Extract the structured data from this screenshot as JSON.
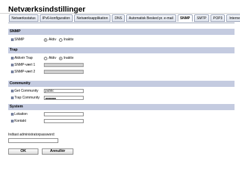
{
  "window": {
    "title": "Netværksindstillinger"
  },
  "tabs": [
    {
      "label": "Netværksstatus",
      "active": false
    },
    {
      "label": "IPv6-konfiguration",
      "active": false
    },
    {
      "label": "Netværksapplikation",
      "active": false
    },
    {
      "label": "DNS",
      "active": false
    },
    {
      "label": "Automatisk Besked pr. e-mail",
      "active": false
    },
    {
      "label": "SNMP",
      "active": true
    },
    {
      "label": "SMTP",
      "active": false
    },
    {
      "label": "POP3",
      "active": false
    },
    {
      "label": "Internetfax",
      "active": false
    }
  ],
  "sections": {
    "snmp": {
      "header": "SNMP",
      "rows": [
        {
          "label": "SNMP",
          "options": [
            "Aktiv",
            "Inaktiv"
          ],
          "selected": "Aktiv"
        }
      ]
    },
    "trap": {
      "header": "Trap",
      "rows": [
        {
          "label": "Aktivér Trap",
          "options": [
            "Aktiv",
            "Inaktiv"
          ],
          "selected": "Inaktiv"
        },
        {
          "label": "SNMP-vært 1",
          "value": "",
          "disabled": true
        },
        {
          "label": "SNMP-vært 2",
          "value": "",
          "disabled": true
        }
      ]
    },
    "community": {
      "header": "Community",
      "rows": [
        {
          "label": "Get Community",
          "value": "public"
        },
        {
          "label": "Trap Community",
          "value": "●●●●●●●●"
        }
      ]
    },
    "system": {
      "header": "System",
      "rows": [
        {
          "label": "Lokation",
          "value": ""
        },
        {
          "label": "Kontakt",
          "value": ""
        }
      ]
    }
  },
  "admin": {
    "label": "Indtast administratorpassword:",
    "value": ""
  },
  "buttons": {
    "ok": "OK",
    "cancel": "Annullér"
  },
  "colors": {
    "section_header": "#c4cbe0",
    "bullet": "#7a84a0",
    "tab_border": "#9aa3b8"
  }
}
